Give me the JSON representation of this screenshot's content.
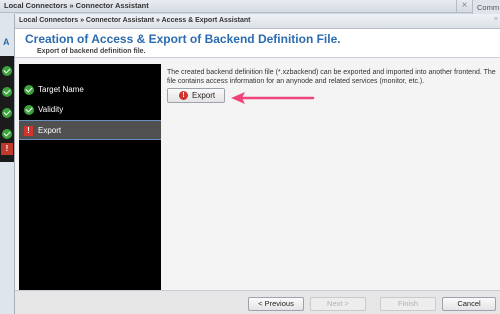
{
  "outer": {
    "title": "Local Connectors » Connector Assistant",
    "close": "×",
    "side_tab": "Comm",
    "strip_letter": "A"
  },
  "dialog": {
    "breadcrumb": "Local Connectors » Connector Assistant » Access & Export Assistant",
    "close": "×",
    "title": "Creation of Access & Export of Backend Definition File.",
    "subtitle": "Export of backend definition file."
  },
  "steps": [
    {
      "label": "Target Name",
      "status": "ok"
    },
    {
      "label": "Validity",
      "status": "ok"
    },
    {
      "label": "Export",
      "status": "error",
      "active": true
    }
  ],
  "content": {
    "description": "The created backend definition file (*.xzbackend) can be exported and imported into another frontend. The file contains access information for an anynode and related services (monitor, etc.).",
    "export_button": "Export",
    "warning_glyph": "!"
  },
  "footer": {
    "previous": "< Previous",
    "next": "Next >",
    "finish": "Finish",
    "cancel": "Cancel"
  },
  "colors": {
    "accent": "#2b6cae",
    "success": "#3da33d",
    "error": "#d0342c",
    "annotation_arrow": "#f0457a"
  }
}
